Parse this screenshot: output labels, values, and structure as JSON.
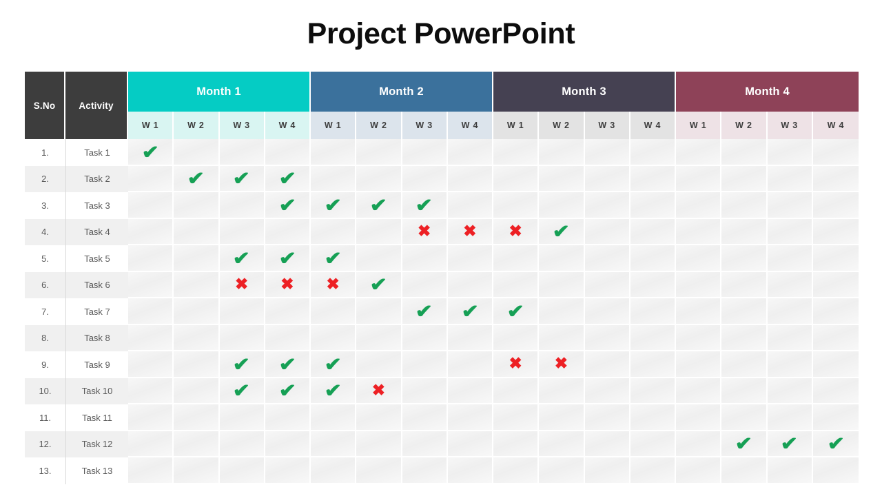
{
  "title": "Project PowerPoint",
  "colors": {
    "month1": "#05CCC4",
    "month2": "#3B719C",
    "month3": "#454152",
    "month4": "#8E4258",
    "month1_week": "#D9F5F2",
    "month2_week": "#DCE4EC",
    "month3_week": "#E3E3E3",
    "month4_week": "#EEE2E6",
    "corner": "#3D3D3D",
    "check": "#16A055",
    "cross": "#ED2024",
    "title": "#0D0D0D"
  },
  "table": {
    "corner_headers": [
      "S.No",
      "Activity"
    ],
    "months": [
      {
        "label": "Month 1",
        "color": "#05CCC4",
        "week_bg": "#D9F5F2"
      },
      {
        "label": "Month 2",
        "color": "#3B719C",
        "week_bg": "#DCE4EC"
      },
      {
        "label": "Month 3",
        "color": "#454152",
        "week_bg": "#E3E3E3"
      },
      {
        "label": "Month 4",
        "color": "#8E4258",
        "week_bg": "#EEE2E6"
      }
    ],
    "week_labels": [
      "W 1",
      "W 2",
      "W 3",
      "W 4"
    ],
    "rows": [
      {
        "sno": "1.",
        "activity": "Task 1",
        "cells": [
          "check",
          "",
          "",
          "",
          "",
          "",
          "",
          "",
          "",
          "",
          "",
          "",
          "",
          "",
          "",
          ""
        ]
      },
      {
        "sno": "2.",
        "activity": "Task 2",
        "cells": [
          "",
          "check",
          "check",
          "check",
          "",
          "",
          "",
          "",
          "",
          "",
          "",
          "",
          "",
          "",
          "",
          ""
        ]
      },
      {
        "sno": "3.",
        "activity": "Task 3",
        "cells": [
          "",
          "",
          "",
          "check",
          "check",
          "check",
          "check",
          "",
          "",
          "",
          "",
          "",
          "",
          "",
          "",
          ""
        ]
      },
      {
        "sno": "4.",
        "activity": "Task 4",
        "cells": [
          "",
          "",
          "",
          "",
          "",
          "",
          "cross",
          "cross",
          "cross",
          "check",
          "",
          "",
          "",
          "",
          "",
          ""
        ]
      },
      {
        "sno": "5.",
        "activity": "Task 5",
        "cells": [
          "",
          "",
          "check",
          "check",
          "check",
          "",
          "",
          "",
          "",
          "",
          "",
          "",
          "",
          "",
          "",
          ""
        ]
      },
      {
        "sno": "6.",
        "activity": "Task 6",
        "cells": [
          "",
          "",
          "cross",
          "cross",
          "cross",
          "check",
          "",
          "",
          "",
          "",
          "",
          "",
          "",
          "",
          "",
          ""
        ]
      },
      {
        "sno": "7.",
        "activity": "Task 7",
        "cells": [
          "",
          "",
          "",
          "",
          "",
          "",
          "check",
          "check",
          "check",
          "",
          "",
          "",
          "",
          "",
          "",
          ""
        ]
      },
      {
        "sno": "8.",
        "activity": "Task 8",
        "cells": [
          "",
          "",
          "",
          "",
          "",
          "",
          "",
          "",
          "",
          "",
          "",
          "",
          "",
          "",
          "",
          ""
        ]
      },
      {
        "sno": "9.",
        "activity": "Task 9",
        "cells": [
          "",
          "",
          "check",
          "check",
          "check",
          "",
          "",
          "",
          "cross",
          "cross",
          "",
          "",
          "",
          "",
          "",
          ""
        ]
      },
      {
        "sno": "10.",
        "activity": "Task 10",
        "cells": [
          "",
          "",
          "check",
          "check",
          "check",
          "cross",
          "",
          "",
          "",
          "",
          "",
          "",
          "",
          "",
          "",
          ""
        ]
      },
      {
        "sno": "11.",
        "activity": "Task 11",
        "cells": [
          "",
          "",
          "",
          "",
          "",
          "",
          "",
          "",
          "",
          "",
          "",
          "",
          "",
          "",
          "",
          ""
        ]
      },
      {
        "sno": "12.",
        "activity": "Task 12",
        "cells": [
          "",
          "",
          "",
          "",
          "",
          "",
          "",
          "",
          "",
          "",
          "",
          "",
          "",
          "check",
          "check",
          "check"
        ]
      },
      {
        "sno": "13.",
        "activity": "Task 13",
        "cells": [
          "",
          "",
          "",
          "",
          "",
          "",
          "",
          "",
          "",
          "",
          "",
          "",
          "",
          "",
          "",
          ""
        ]
      }
    ]
  },
  "glyphs": {
    "check": "✔",
    "cross": "✖"
  }
}
